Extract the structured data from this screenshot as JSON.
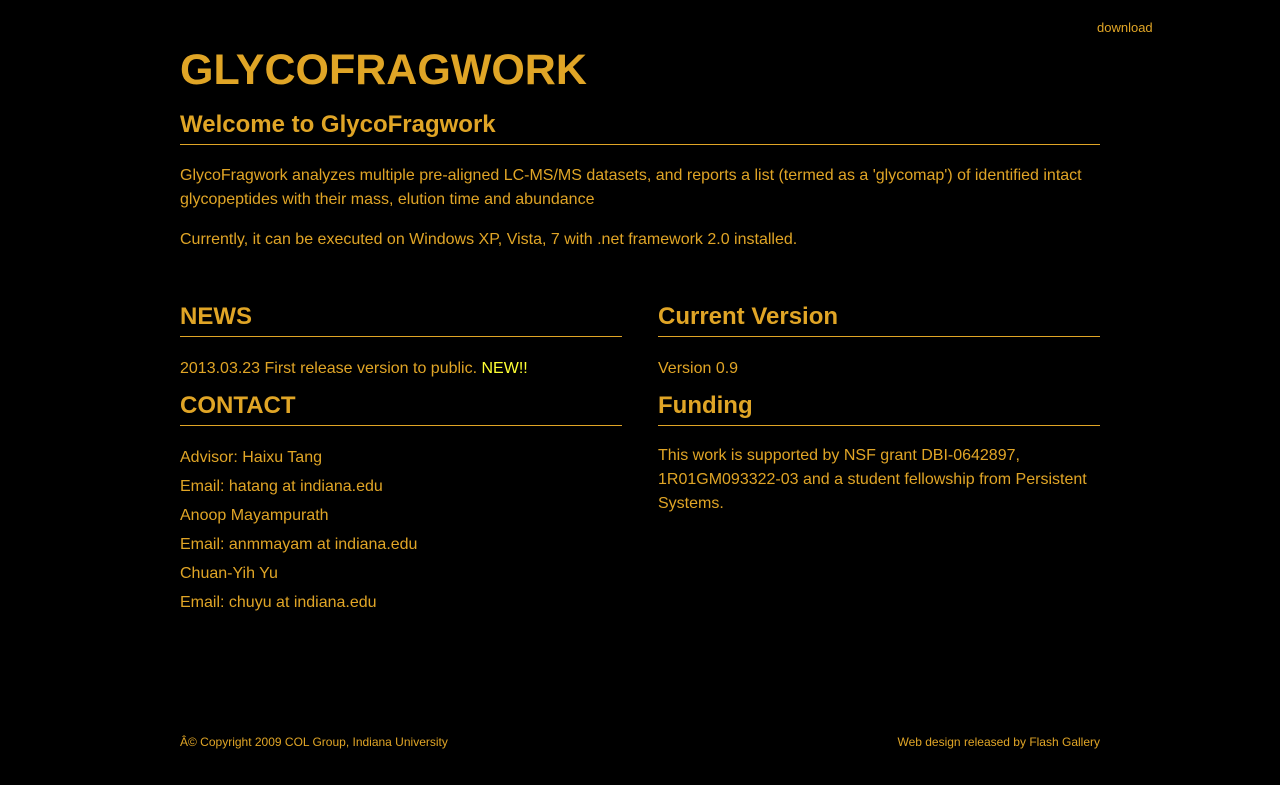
{
  "header": {
    "download_label": "download",
    "site_title": "GLYCOFRAGWORK"
  },
  "welcome": {
    "heading": "Welcome to GlycoFragwork",
    "paragraph1": "GlycoFragwork analyzes multiple pre-aligned LC-MS/MS datasets, and reports a list (termed as a 'glycomap') of identified intact glycopeptides with their mass, elution time and abundance",
    "paragraph2": "Currently, it can be executed on Windows XP, Vista, 7 with .net framework 2.0 installed."
  },
  "news": {
    "heading": "NEWS",
    "item_text": "2013.03.23 First release version to public. ",
    "item_badge": "NEW!!"
  },
  "contact": {
    "heading": "CONTACT",
    "lines": [
      "Advisor: Haixu Tang",
      "Email: hatang at indiana.edu",
      "Anoop Mayampurath",
      "Email: anmmayam at indiana.edu",
      "Chuan-Yih Yu",
      "Email: chuyu at indiana.edu"
    ]
  },
  "current_version": {
    "heading": "Current Version",
    "text": "Version 0.9"
  },
  "funding": {
    "heading": "Funding",
    "text": "This work is supported by NSF grant DBI-0642897, 1R01GM093322-03 and a student fellowship from Persistent Systems."
  },
  "footer": {
    "copyright": "Â© Copyright 2009 COL Group, Indiana University",
    "credit_prefix": "Web design released by ",
    "credit_link": "Flash Gallery"
  },
  "colors": {
    "background": "#000000",
    "text": "#e0a526",
    "new_badge": "#ffff33"
  }
}
